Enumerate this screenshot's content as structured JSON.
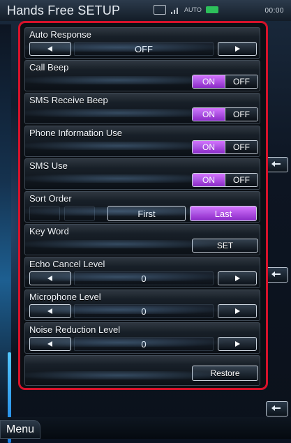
{
  "header": {
    "title": "Hands Free SETUP",
    "status_auto": "AUTO",
    "clock": "00:00"
  },
  "rows": {
    "auto_response": {
      "label": "Auto Response",
      "value": "OFF"
    },
    "call_beep": {
      "label": "Call Beep",
      "on": "ON",
      "off": "OFF"
    },
    "sms_receive_beep": {
      "label": "SMS Receive Beep",
      "on": "ON",
      "off": "OFF"
    },
    "phone_information_use": {
      "label": "Phone Information Use",
      "on": "ON",
      "off": "OFF"
    },
    "sms_use": {
      "label": "SMS Use",
      "on": "ON",
      "off": "OFF"
    },
    "sort_order": {
      "label": "Sort Order",
      "first": "First",
      "last": "Last"
    },
    "key_word": {
      "label": "Key Word",
      "set": "SET"
    },
    "echo_cancel_level": {
      "label": "Echo Cancel Level",
      "value": "0"
    },
    "microphone_level": {
      "label": "Microphone Level",
      "value": "0"
    },
    "noise_reduction_level": {
      "label": "Noise Reduction Level",
      "value": "0"
    }
  },
  "footer": {
    "restore": "Restore",
    "menu": "Menu"
  },
  "colors": {
    "panel_border": "#d7122a",
    "accent_on": "#b44de6",
    "battery": "#2fd15f"
  },
  "icons": [
    "left-arrow-icon",
    "right-arrow-icon",
    "back-icon",
    "signal-icon",
    "battery-icon",
    "message-icon"
  ]
}
